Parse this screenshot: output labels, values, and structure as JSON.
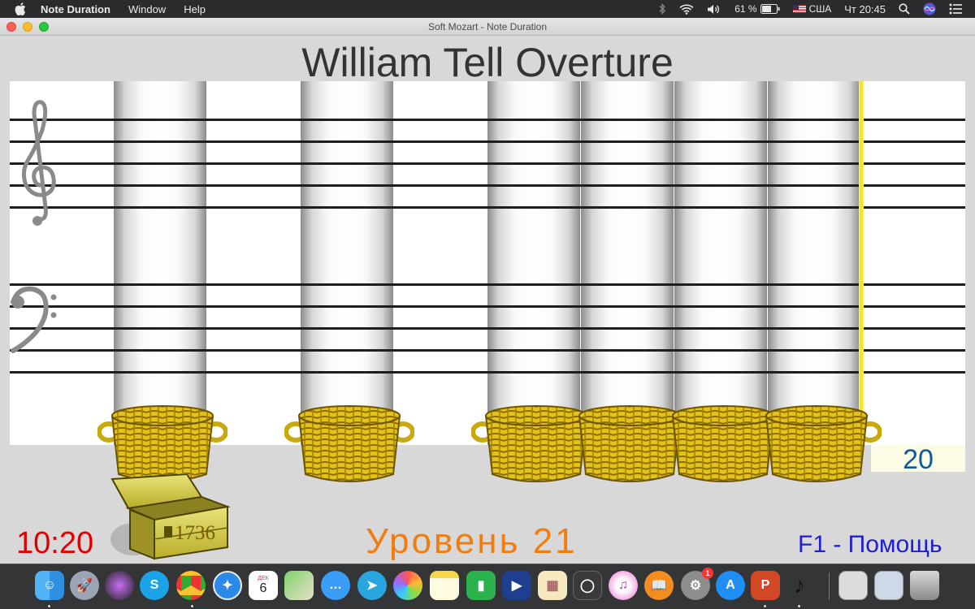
{
  "menubar": {
    "app_name": "Note Duration",
    "menus": [
      "Window",
      "Help"
    ],
    "battery": "61 %",
    "input_source": "США",
    "clock": "Чт 20:45"
  },
  "window": {
    "title": "Soft Mozart - Note Duration"
  },
  "game": {
    "song_title": "William Tell Overture",
    "counter": "20",
    "chest_score": "1736",
    "timer": "10:20",
    "level": "Уровень 21",
    "help": "F1 - Помощь"
  },
  "dock": {
    "calendar_month": "ДЕК",
    "calendar_day": "6",
    "updates_badge": "1"
  }
}
